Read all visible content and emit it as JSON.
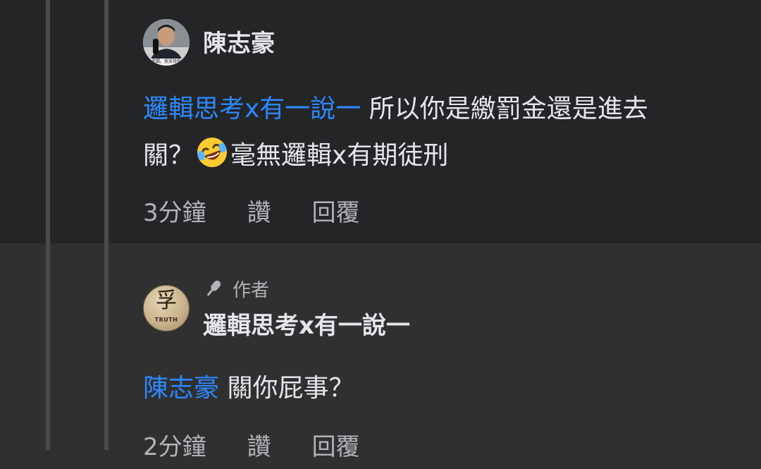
{
  "comments": [
    {
      "author": "陳志豪",
      "mention": "邏輯思考x有一說一",
      "text_line1": " 所以你是繳罰金還是進去",
      "text_line2_pre": "關？",
      "emoji_icon": "laughing-tears-emoji",
      "text_line2_post": "毫無邏輯x有期徒刑",
      "time": "3分鐘",
      "like_label": "讚",
      "reply_label": "回覆",
      "avatar_caption": "老闆，我支持你"
    },
    {
      "author": "邏輯思考x有一說一",
      "badge": "作者",
      "badge_icon": "microphone-icon",
      "avatar_glyph": "孚",
      "avatar_word": "TRUTH",
      "mention": "陳志豪",
      "text": " 關你屁事？",
      "time": "2分鐘",
      "like_label": "讚",
      "reply_label": "回覆"
    }
  ],
  "colors": {
    "background": "#242526",
    "highlight_background": "#303031",
    "mention": "#2d88ff",
    "primary_text": "#e4e6eb",
    "secondary_text": "#b0b3b8"
  }
}
